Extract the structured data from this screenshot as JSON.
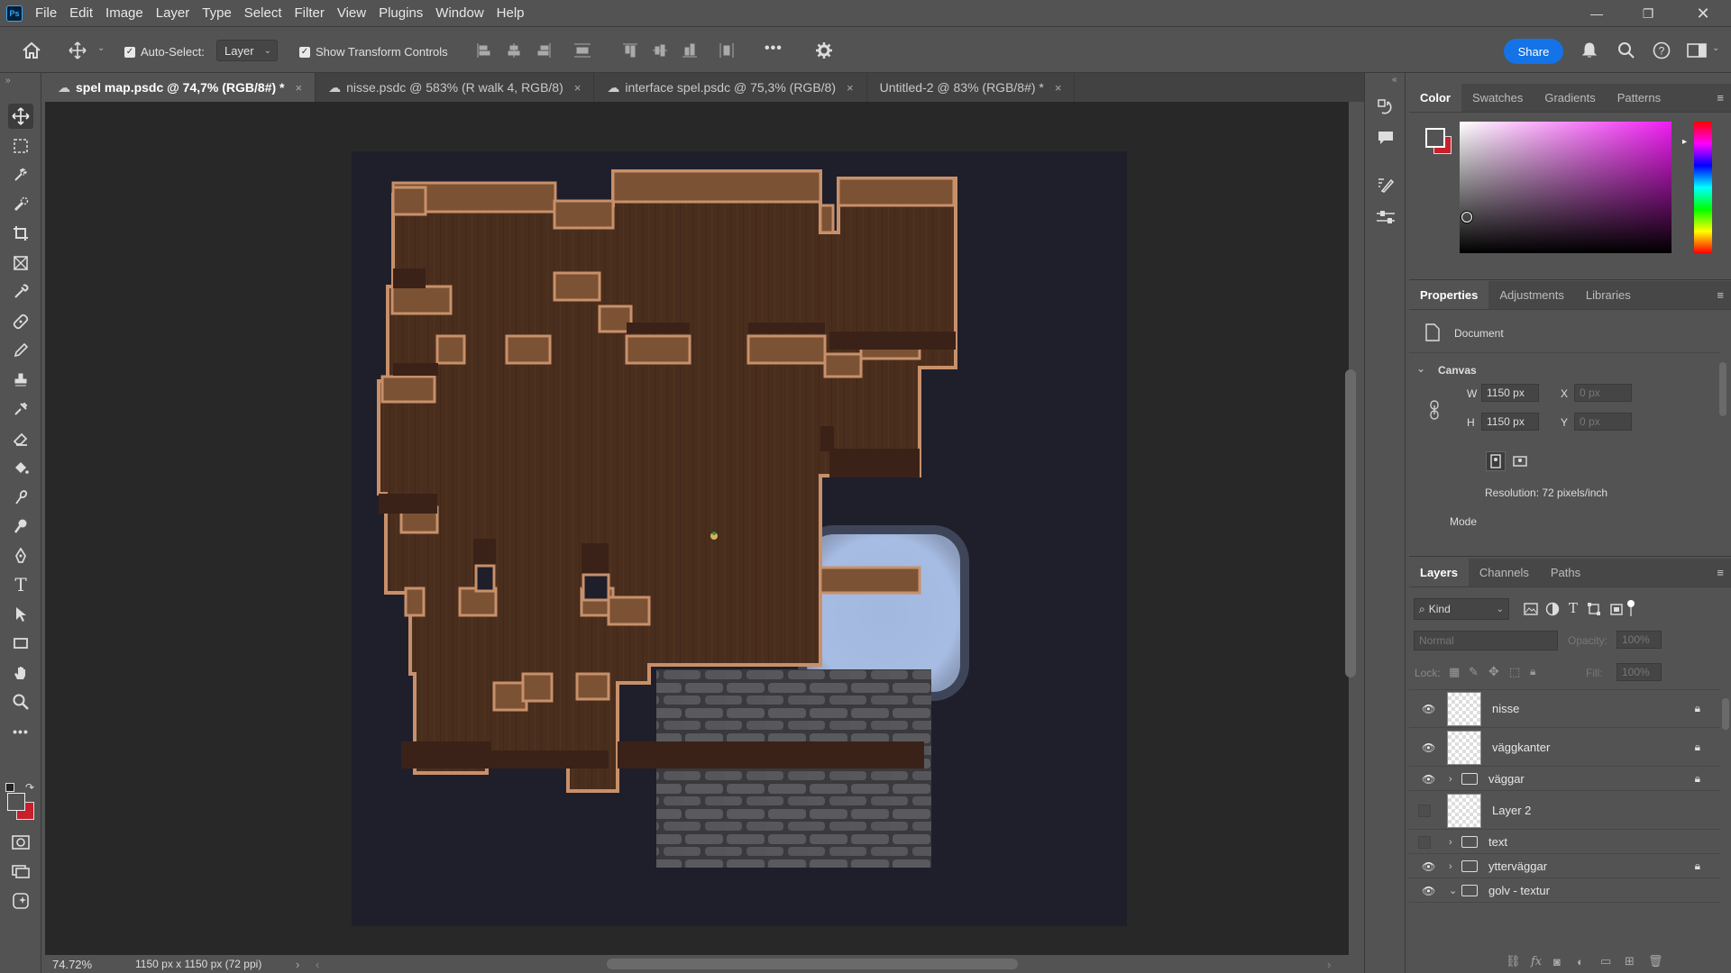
{
  "app": {
    "logo": "Ps"
  },
  "menu": [
    "File",
    "Edit",
    "Image",
    "Layer",
    "Type",
    "Select",
    "Filter",
    "View",
    "Plugins",
    "Window",
    "Help"
  ],
  "options": {
    "auto_select_label": "Auto-Select:",
    "auto_select_value": "Layer",
    "show_transform_label": "Show Transform Controls",
    "more": "•••",
    "share": "Share"
  },
  "tabs": [
    {
      "label": "spel map.psdc @ 74,7% (RGB/8#) *",
      "active": true,
      "cloud": true
    },
    {
      "label": "nisse.psdc @ 583% (R walk 4, RGB/8)",
      "active": false,
      "cloud": true
    },
    {
      "label": "interface spel.psdc @ 75,3% (RGB/8)",
      "active": false,
      "cloud": true
    },
    {
      "label": "Untitled-2 @ 83% (RGB/8#) *",
      "active": false,
      "cloud": false
    }
  ],
  "status": {
    "zoom": "74.72%",
    "doc_info": "1150 px x 1150 px (72 ppi)",
    "arrow": "›"
  },
  "color_panel": {
    "tabs": [
      "Color",
      "Swatches",
      "Gradients",
      "Patterns"
    ],
    "foreground": "#ffffff",
    "background": "#c8202a"
  },
  "properties_panel": {
    "tabs": [
      "Properties",
      "Adjustments",
      "Libraries"
    ],
    "document_label": "Document",
    "canvas_label": "Canvas",
    "w_label": "W",
    "w_value": "1150 px",
    "h_label": "H",
    "h_value": "1150 px",
    "x_label": "X",
    "x_value": "0 px",
    "y_label": "Y",
    "y_value": "0 px",
    "resolution": "Resolution: 72 pixels/inch",
    "mode_label": "Mode"
  },
  "layers_panel": {
    "tabs": [
      "Layers",
      "Channels",
      "Paths"
    ],
    "kind": "Kind",
    "blend_mode": "Normal",
    "opacity_label": "Opacity:",
    "opacity_value": "100%",
    "lock_label": "Lock:",
    "fill_label": "Fill:",
    "fill_value": "100%",
    "layers": [
      {
        "name": "nisse",
        "visible": true,
        "type": "pixel",
        "locked": true
      },
      {
        "name": "väggkanter",
        "visible": true,
        "type": "pixel",
        "locked": true
      },
      {
        "name": "väggar",
        "visible": true,
        "type": "group",
        "locked": true
      },
      {
        "name": "Layer 2",
        "visible": false,
        "type": "pixel",
        "locked": false
      },
      {
        "name": "text",
        "visible": false,
        "type": "group",
        "locked": false
      },
      {
        "name": "ytterväggar",
        "visible": true,
        "type": "group",
        "locked": true
      },
      {
        "name": "golv - textur",
        "visible": true,
        "type": "group-open",
        "locked": false
      }
    ]
  },
  "colors": {
    "wood": "#4a2e1d",
    "wall_top": "#7b5234",
    "wall_edge": "#c8906a",
    "stone": "#56565a",
    "water": "#a7bde0",
    "bg": "#1f1f2b"
  }
}
